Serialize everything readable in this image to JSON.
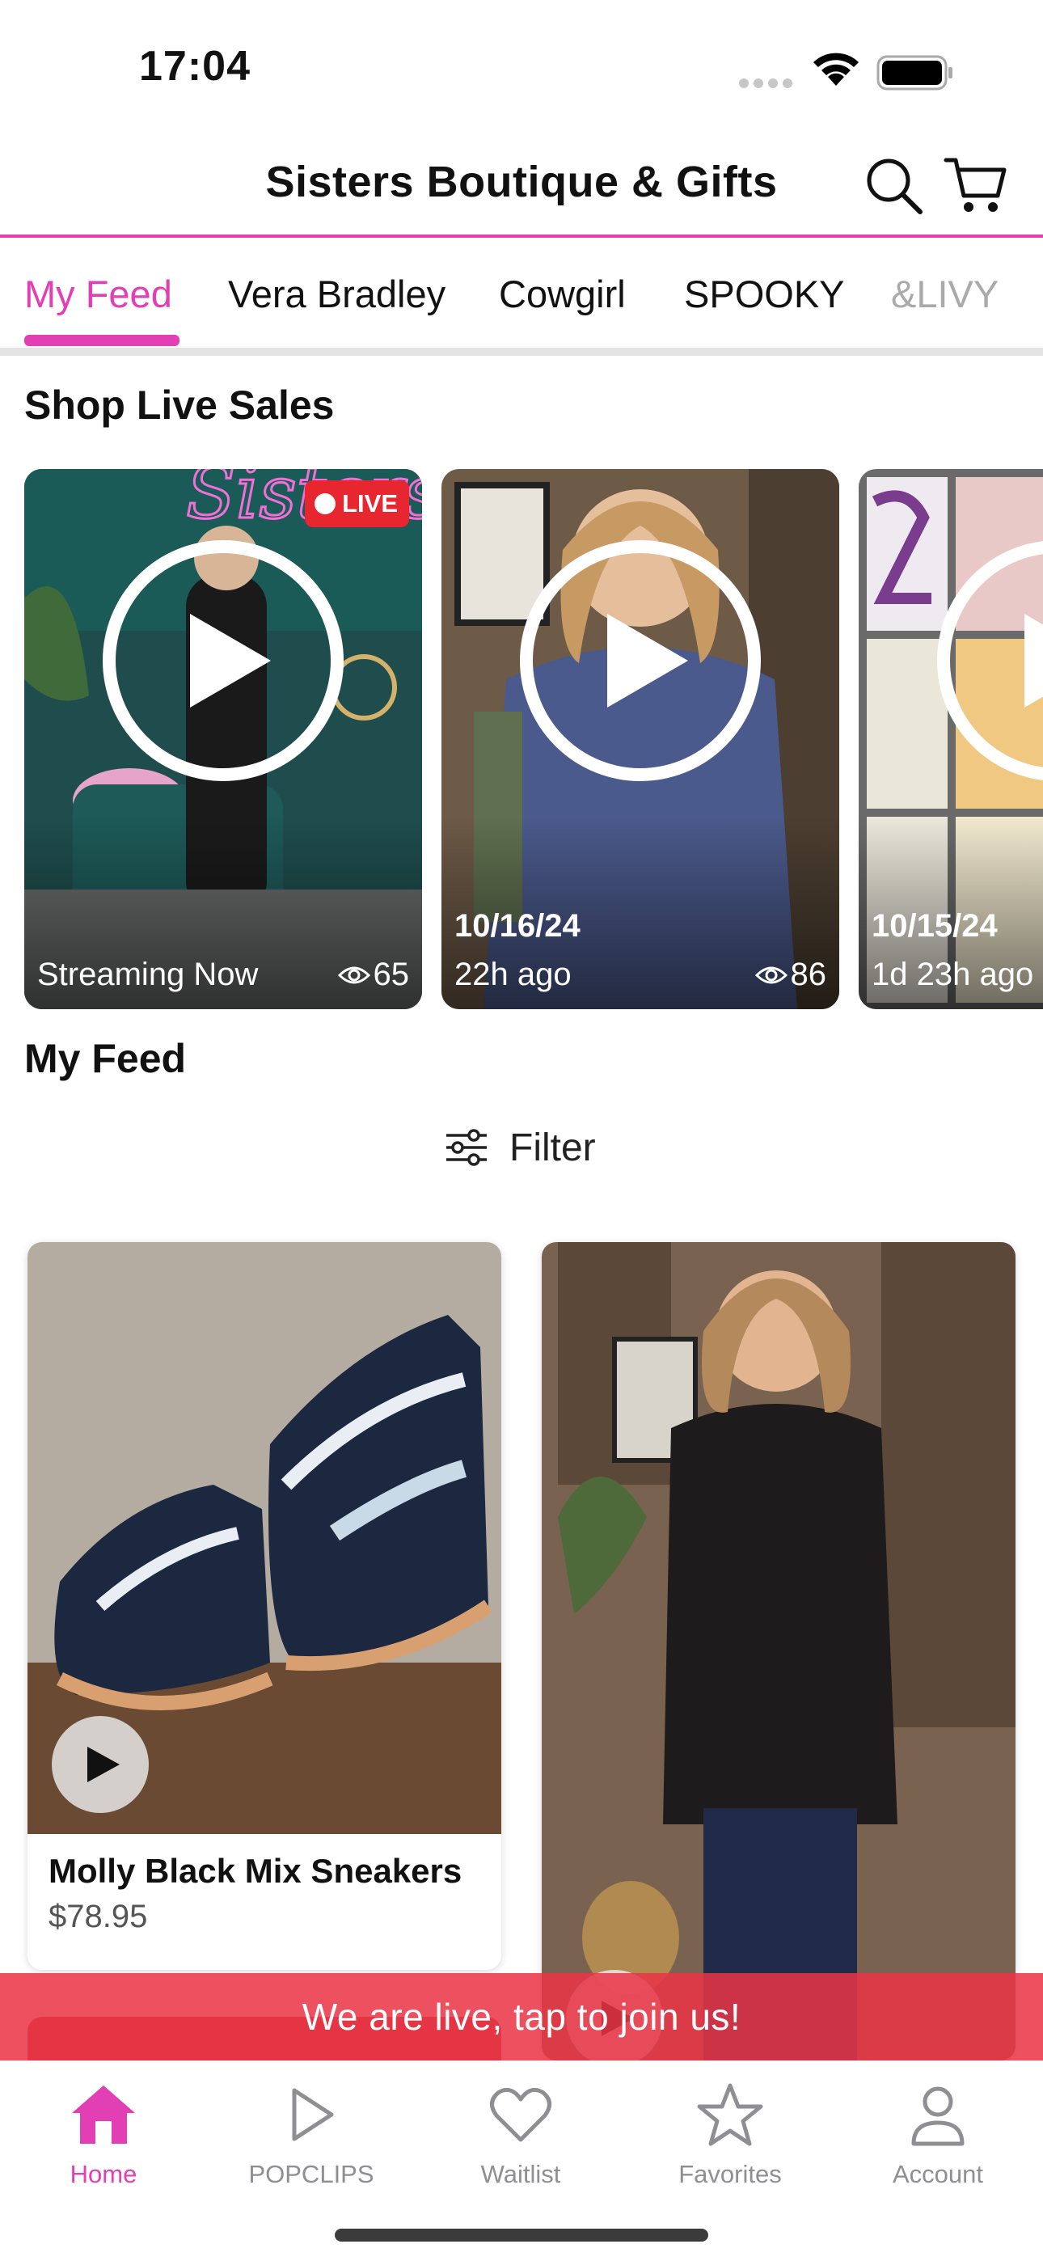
{
  "status_bar": {
    "time": "17:04"
  },
  "header": {
    "title": "Sisters Boutique & Gifts"
  },
  "tabs": [
    {
      "label": "My Feed",
      "active": true
    },
    {
      "label": "Vera Bradley"
    },
    {
      "label": "Cowgirl"
    },
    {
      "label": "SPOOKY"
    },
    {
      "label": "&LIVY"
    }
  ],
  "live_section": {
    "heading": "Shop Live Sales",
    "cards": [
      {
        "badge": "LIVE",
        "date": "",
        "status": "Streaming Now",
        "views": "65"
      },
      {
        "badge": "",
        "date": "10/16/24",
        "status": "22h ago",
        "views": "86"
      },
      {
        "badge": "",
        "date": "10/15/24",
        "status": "1d 23h ago",
        "views": ""
      }
    ]
  },
  "feed": {
    "heading": "My Feed",
    "filter_label": "Filter",
    "products": [
      {
        "name": "Molly Black Mix Sneakers",
        "price": "$78.95"
      },
      {
        "name": "",
        "price": ""
      }
    ]
  },
  "live_banner": {
    "text": "We are live, tap to join us!"
  },
  "tab_bar": [
    {
      "label": "Home",
      "icon": "home-icon",
      "active": true
    },
    {
      "label": "POPCLIPS",
      "icon": "play-icon"
    },
    {
      "label": "Waitlist",
      "icon": "heart-icon"
    },
    {
      "label": "Favorites",
      "icon": "star-icon"
    },
    {
      "label": "Account",
      "icon": "person-icon"
    }
  ],
  "colors": {
    "accent": "#e23fb4",
    "live_red": "#e8262f",
    "banner_red": "#ea3446"
  }
}
